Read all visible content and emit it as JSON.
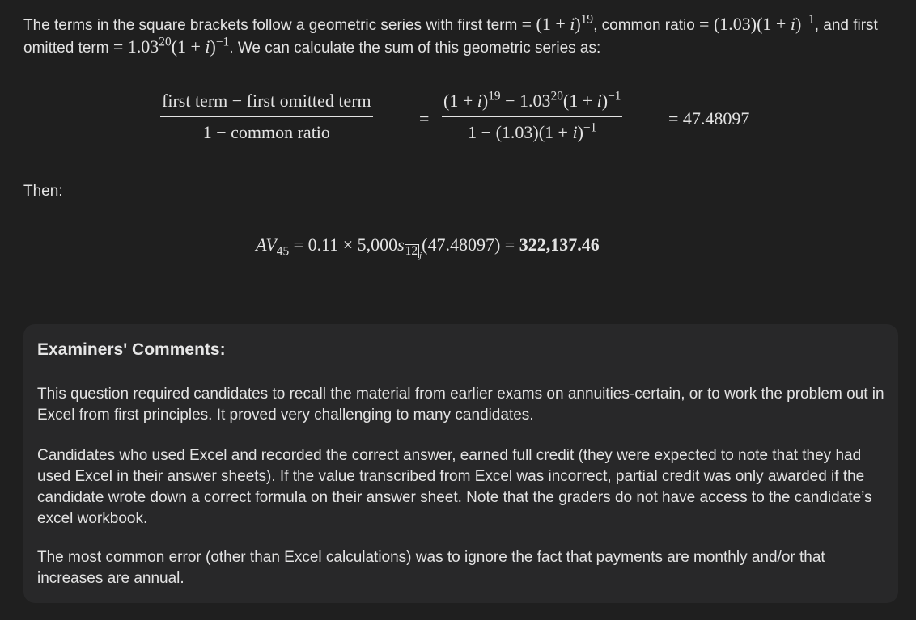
{
  "intro": {
    "t1": "The terms in the square brackets follow a geometric series with first term",
    "m1": "= (1 + ",
    "m1_var": "i",
    "m1_close": ")",
    "m1_exp": "19",
    "t2": ", common ratio",
    "m2": "= (1.03)(1 + ",
    "m2_var": "i",
    "m2_close": ")",
    "m2_exp": "−1",
    "t3": ",",
    "t4": "and first omitted term",
    "m3a": "= 1.03",
    "m3a_exp": "20",
    "m3b": "(1 + ",
    "m3b_var": "i",
    "m3b_close": ")",
    "m3b_exp": "−1",
    "t5": ". We can calculate the sum of this geometric series as:"
  },
  "display1": {
    "frac1_num": "first term − first omitted term",
    "frac1_den": "1 − common ratio",
    "eq1": "=",
    "frac2_num_a": "(1 + ",
    "frac2_num_var": "i",
    "frac2_num_b": ")",
    "frac2_num_exp1": "19",
    "frac2_num_c": " − 1.03",
    "frac2_num_exp2": "20",
    "frac2_num_d": "(1 + ",
    "frac2_num_var2": "i",
    "frac2_num_e": ")",
    "frac2_num_exp3": "−1",
    "frac2_den_a": "1 − (1.03)(1 + ",
    "frac2_den_var": "i",
    "frac2_den_b": ")",
    "frac2_den_exp": "−1",
    "result": "= 47.48097"
  },
  "then_label": "Then:",
  "display2": {
    "lhs": "AV",
    "lhs_sub": "45",
    "mid": " = 0.11 × 5,000",
    "s": "s",
    "s_sub_ang": "12",
    "s_sub_j": "j",
    "paren": "(47.48097) = ",
    "answer": "322,137.46"
  },
  "comments": {
    "title": "Examiners' Comments:",
    "p1": "This question required candidates to recall the material from earlier exams on annuities-certain, or to work the problem out in Excel from first principles. It proved very challenging to many candidates.",
    "p2": "Candidates who used Excel and recorded the correct answer, earned full credit (they were expected to note that they had used Excel in their answer sheets). If the value transcribed from Excel was incorrect, partial credit was only awarded if the candidate wrote down a correct formula on their answer sheet. Note that the graders do not have access to the candidate’s excel workbook.",
    "p3": "The most common error (other than Excel calculations) was to ignore the fact that payments are monthly and/or that increases are annual."
  }
}
